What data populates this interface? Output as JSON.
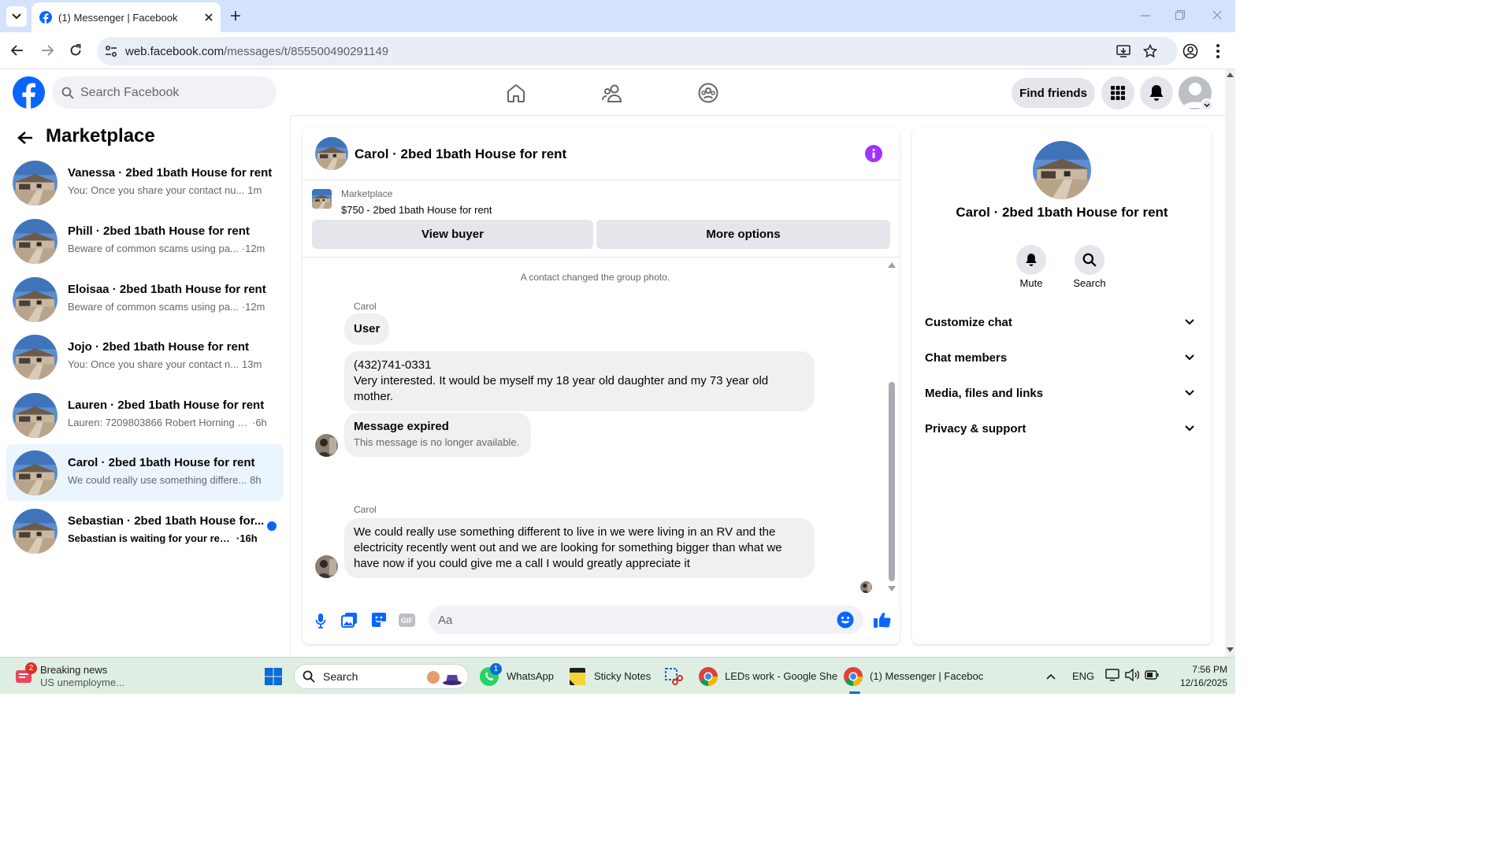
{
  "browser": {
    "tab_title": "(1) Messenger | Facebook",
    "url_host": "web.facebook.com",
    "url_path": "/messages/t/855500490291149"
  },
  "header": {
    "search_placeholder": "Search Facebook",
    "find_friends": "Find friends"
  },
  "sidebar": {
    "title": "Marketplace",
    "conversations": [
      {
        "title": "Vanessa · 2bed 1bath House for rent",
        "preview": "You: Once you share your contact nu...",
        "time": "1m"
      },
      {
        "title": "Phill · 2bed 1bath House for rent",
        "preview": "Beware of common scams using pa...",
        "time": "·12m"
      },
      {
        "title": "Eloisaa · 2bed 1bath House for rent",
        "preview": "Beware of common scams using pa...",
        "time": "·12m"
      },
      {
        "title": "Jojo · 2bed 1bath House for rent",
        "preview": "You: Once you share your contact n...",
        "time": "13m"
      },
      {
        "title": "Lauren · 2bed 1bath House for rent",
        "preview": "Lauren: 7209803866 Robert Horning (...",
        "time": "·6h"
      },
      {
        "title": "Carol · 2bed 1bath House for rent",
        "preview": "We could really use something differe...",
        "time": "8h"
      },
      {
        "title": "Sebastian · 2bed 1bath House for...",
        "preview": "Sebastian is waiting for your resp...",
        "time": "·16h"
      }
    ]
  },
  "chat": {
    "title": "Carol · 2bed 1bath House for rent",
    "listing_source": "Marketplace",
    "listing_title": "$750 - 2bed 1bath House for rent",
    "view_buyer": "View buyer",
    "more_options": "More options",
    "system_message": "A contact changed the group photo.",
    "sender1": "Carol",
    "msg1": "User",
    "msg2_phone": "(432)741-0331",
    "msg2_text": "Very interested. It would be myself my 18 year old daughter and my 73 year old mother.",
    "expired_title": "Message expired",
    "expired_sub": "This message is no longer available.",
    "sender2": "Carol",
    "msg3": "We could really use something different to live in we were living in an RV and the electricity recently went out and we are looking for something bigger than what we have now if you could give me a call I would greatly appreciate it",
    "composer_placeholder": "Aa"
  },
  "info": {
    "name": "Carol · 2bed 1bath House for rent",
    "mute": "Mute",
    "search": "Search",
    "sections": [
      "Customize chat",
      "Chat members",
      "Media, files and links",
      "Privacy & support"
    ]
  },
  "taskbar": {
    "news_title": "Breaking news",
    "news_sub": "US unemployme...",
    "news_badge": "2",
    "search": "Search",
    "whatsapp": "WhatsApp",
    "whatsapp_badge": "1",
    "sticky": "Sticky Notes",
    "chrome1": "LEDs work - Google She",
    "chrome2": "(1) Messenger | Faceboc",
    "lang": "ENG",
    "time": "7:56 PM",
    "date": "12/16/2025"
  }
}
